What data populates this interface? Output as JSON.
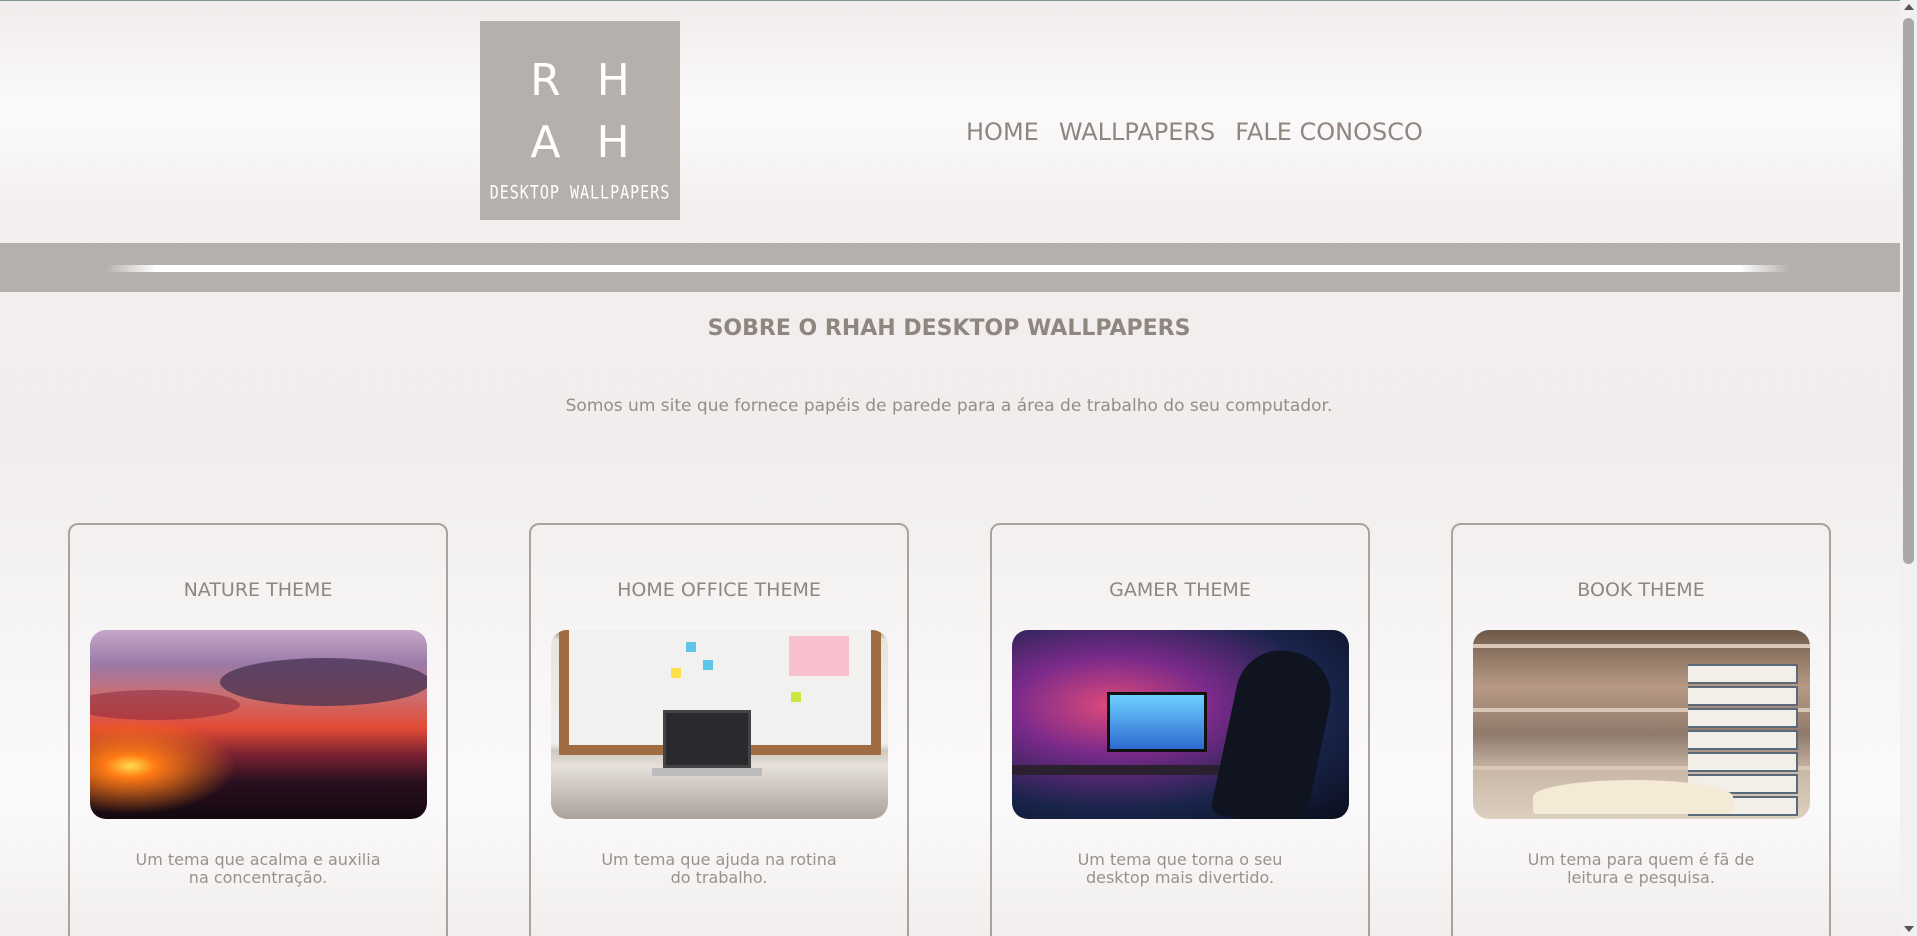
{
  "logo": {
    "letters_row1": "RH",
    "letters_row2": "AH",
    "subtitle": "DESKTOP WALLPAPERS"
  },
  "nav": {
    "items": [
      {
        "label": "HOME"
      },
      {
        "label": "WALLPAPERS"
      },
      {
        "label": "FALE CONOSCO"
      }
    ]
  },
  "about": {
    "title": "SOBRE O RHAH DESKTOP WALLPAPERS",
    "text": "Somos um site que fornece papéis de parede para a área de trabalho do seu computador."
  },
  "cards": [
    {
      "title": "NATURE THEME",
      "description": "Um tema que acalma e auxilia na concentração.",
      "image": "sunset-beach-image"
    },
    {
      "title": "HOME OFFICE THEME",
      "description": "Um tema que ajuda na rotina do trabalho.",
      "image": "home-office-desk-image"
    },
    {
      "title": "GAMER THEME",
      "description": "Um tema que torna o seu desktop mais divertido.",
      "image": "gamer-setup-image"
    },
    {
      "title": "BOOK THEME",
      "description": "Um tema para quem é fã de leitura e pesquisa.",
      "image": "library-books-image"
    }
  ],
  "colors": {
    "logo_bg": "#b5b0ac",
    "band_bg": "#b5b0ac",
    "text": "#8f8680",
    "card_border": "#a9a3a0"
  }
}
